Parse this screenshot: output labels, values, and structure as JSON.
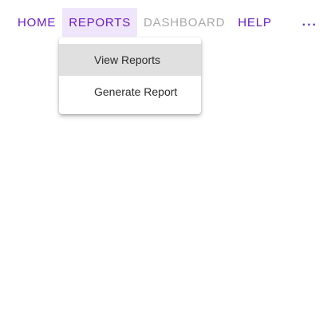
{
  "menubar": {
    "items": [
      {
        "label": "HOME",
        "state": "normal"
      },
      {
        "label": "REPORTS",
        "state": "active"
      },
      {
        "label": "DASHBOARD",
        "state": "disabled"
      },
      {
        "label": "HELP",
        "state": "normal"
      }
    ],
    "overflow_label": "...",
    "accent_color": "#6a1bc9",
    "disabled_color": "#a9a9a9"
  },
  "reports_menu": {
    "items": [
      {
        "label": "View Reports",
        "highlighted": true
      },
      {
        "label": "Generate Report",
        "highlighted": false
      }
    ],
    "highlight_color": "#e0e0e0"
  }
}
